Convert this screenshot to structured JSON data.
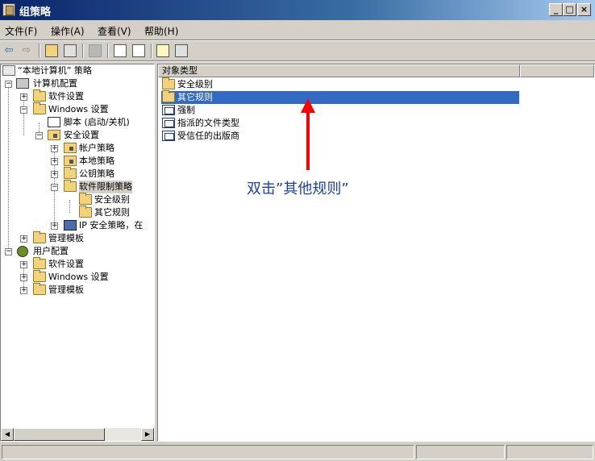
{
  "window": {
    "title": "组策略",
    "minimize": "_",
    "maximize": "□",
    "close": "×"
  },
  "menu": [
    {
      "label": "文件(F)"
    },
    {
      "label": "操作(A)"
    },
    {
      "label": "查看(V)"
    },
    {
      "label": "帮助(H)"
    }
  ],
  "toolbar": {
    "back": "⇦",
    "forward": "⇨"
  },
  "tree": [
    {
      "label": "“本地计算机” 策略",
      "level": 0,
      "expander": "",
      "icon": "policy-icon"
    },
    {
      "label": "计算机配置",
      "level": 1,
      "expander": "−",
      "icon": "computer-icon"
    },
    {
      "label": "软件设置",
      "level": 2,
      "expander": "+",
      "icon": "folder-icon"
    },
    {
      "label": "Windows 设置",
      "level": 2,
      "expander": "−",
      "icon": "folder-icon"
    },
    {
      "label": "脚本 (启动/关机)",
      "level": 3,
      "expander": "",
      "icon": "script-icon"
    },
    {
      "label": "安全设置",
      "level": 3,
      "expander": "−",
      "icon": "lock-icon"
    },
    {
      "label": "帐户策略",
      "level": 4,
      "expander": "+",
      "icon": "lock-icon"
    },
    {
      "label": "本地策略",
      "level": 4,
      "expander": "+",
      "icon": "lock-icon"
    },
    {
      "label": "公钥策略",
      "level": 4,
      "expander": "+",
      "icon": "folder-icon"
    },
    {
      "label": "软件限制策略",
      "level": 4,
      "expander": "−",
      "icon": "folder-icon",
      "selected": true
    },
    {
      "label": "安全级别",
      "level": 5,
      "expander": "",
      "icon": "folder-icon"
    },
    {
      "label": "其它规则",
      "level": 5,
      "expander": "",
      "icon": "folder-icon"
    },
    {
      "label": "IP 安全策略，在",
      "level": 4,
      "expander": "+",
      "icon": "ip-security-icon"
    },
    {
      "label": "管理模板",
      "level": 2,
      "expander": "+",
      "icon": "folder-icon"
    },
    {
      "label": "用户配置",
      "level": 1,
      "expander": "−",
      "icon": "user-icon"
    },
    {
      "label": "软件设置",
      "level": 2,
      "expander": "+",
      "icon": "folder-icon"
    },
    {
      "label": "Windows 设置",
      "level": 2,
      "expander": "+",
      "icon": "folder-icon"
    },
    {
      "label": "管理模板",
      "level": 2,
      "expander": "+",
      "icon": "folder-icon"
    }
  ],
  "list": {
    "column_header": "对象类型",
    "items": [
      {
        "label": "安全级别",
        "icon": "folder-icon"
      },
      {
        "label": "其它规则",
        "icon": "folder-icon",
        "selected": true
      },
      {
        "label": "强制",
        "icon": "rule-icon"
      },
      {
        "label": "指派的文件类型",
        "icon": "rule-icon"
      },
      {
        "label": "受信任的出版商",
        "icon": "rule-icon"
      }
    ]
  },
  "annotation": {
    "text": "双击”其他规则”",
    "color": "#1f3fa8",
    "arrow_color": "#ff0000"
  },
  "colors": {
    "titlebar": "#0a246a",
    "selection": "#316ac5",
    "face": "#d4d0c8"
  }
}
